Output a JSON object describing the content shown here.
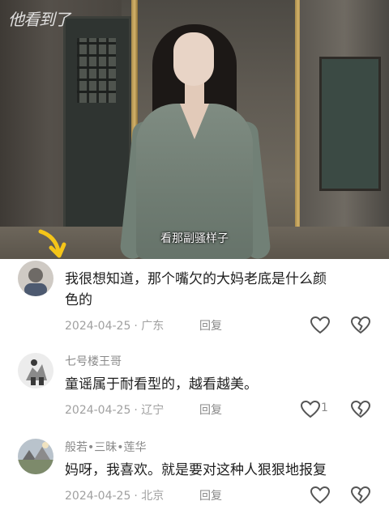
{
  "video": {
    "logo_text": "他看到了",
    "subtitle": "看那副骚样子"
  },
  "comments": [
    {
      "username": "",
      "text_line1": "我很想知道，那个嘴欠的大妈老底是什么颜",
      "text_line2": "色的",
      "date": "2024-04-25",
      "location": "· 广东",
      "reply_label": "回复",
      "like_count": ""
    },
    {
      "username": "七号楼王哥",
      "text_line1": "童谣属于耐看型的，越看越美。",
      "date": "2024-04-25",
      "location": "· 辽宁",
      "reply_label": "回复",
      "like_count": "1"
    },
    {
      "username": "般若•三昧•莲华",
      "text_line1": "妈呀，我喜欢。就是要对这种人狠狠地报复",
      "date": "2024-04-25",
      "location": "· 北京",
      "reply_label": "回复",
      "like_count": ""
    }
  ],
  "colors": {
    "accent_arrow": "#f5c518",
    "text_primary": "#1e1e1e",
    "text_secondary": "#8a8a8a"
  }
}
